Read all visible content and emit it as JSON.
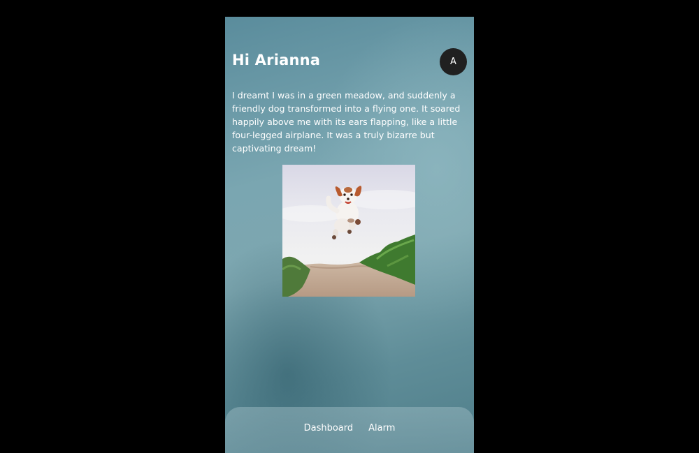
{
  "header": {
    "greeting": "Hi Arianna",
    "avatar_initial": "A"
  },
  "dream": {
    "text": "I dreamt I was in a green meadow, and suddenly a friendly dog transformed into a flying one. It soared happily above me with its ears flapping, like a little four-legged airplane. It was a truly bizarre but captivating dream!"
  },
  "nav": {
    "items": [
      {
        "label": "Dashboard"
      },
      {
        "label": "Alarm"
      }
    ]
  },
  "colors": {
    "page_background": "#000000",
    "avatar_background": "#202020",
    "text": "#ffffff"
  }
}
